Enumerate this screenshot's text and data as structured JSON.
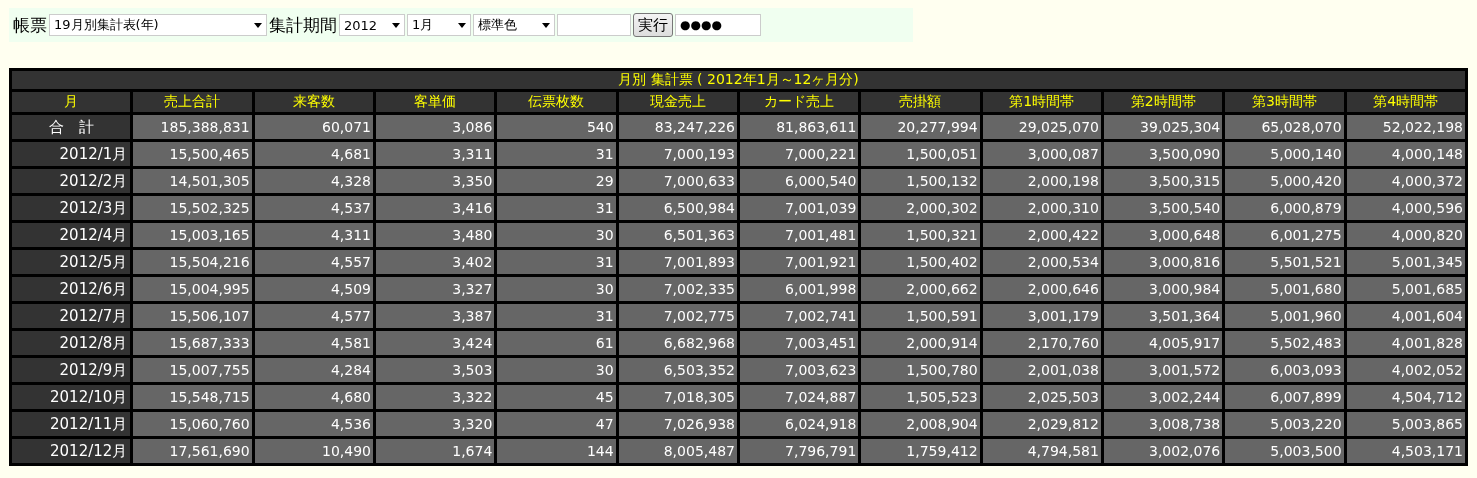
{
  "toolbar": {
    "report_label": "帳票",
    "report_select": "19月別集計表(年)",
    "period_label": "集計期間",
    "year_select": "2012",
    "month_select": "1月",
    "color_select": "標準色",
    "run_button": "実行",
    "password_field": "●●●●"
  },
  "table": {
    "title": "月別 集計票 ( 2012年1月～12ヶ月分)",
    "columns": [
      "月",
      "売上合計",
      "来客数",
      "客単価",
      "伝票枚数",
      "現金売上",
      "カード売上",
      "売掛額",
      "第1時間帯",
      "第2時間帯",
      "第3時間帯",
      "第4時間帯"
    ],
    "rows": [
      {
        "kind": "total",
        "cells": [
          "合　計",
          "185,388,831",
          "60,071",
          "3,086",
          "540",
          "83,247,226",
          "81,863,611",
          "20,277,994",
          "29,025,070",
          "39,025,304",
          "65,028,070",
          "52,022,198"
        ]
      },
      {
        "kind": "month",
        "cells": [
          "2012/1月",
          "15,500,465",
          "4,681",
          "3,311",
          "31",
          "7,000,193",
          "7,000,221",
          "1,500,051",
          "3,000,087",
          "3,500,090",
          "5,000,140",
          "4,000,148"
        ]
      },
      {
        "kind": "month",
        "cells": [
          "2012/2月",
          "14,501,305",
          "4,328",
          "3,350",
          "29",
          "7,000,633",
          "6,000,540",
          "1,500,132",
          "2,000,198",
          "3,500,315",
          "5,000,420",
          "4,000,372"
        ]
      },
      {
        "kind": "month",
        "cells": [
          "2012/3月",
          "15,502,325",
          "4,537",
          "3,416",
          "31",
          "6,500,984",
          "7,001,039",
          "2,000,302",
          "2,000,310",
          "3,500,540",
          "6,000,879",
          "4,000,596"
        ]
      },
      {
        "kind": "month",
        "cells": [
          "2012/4月",
          "15,003,165",
          "4,311",
          "3,480",
          "30",
          "6,501,363",
          "7,001,481",
          "1,500,321",
          "2,000,422",
          "3,000,648",
          "6,001,275",
          "4,000,820"
        ]
      },
      {
        "kind": "month",
        "cells": [
          "2012/5月",
          "15,504,216",
          "4,557",
          "3,402",
          "31",
          "7,001,893",
          "7,001,921",
          "1,500,402",
          "2,000,534",
          "3,000,816",
          "5,501,521",
          "5,001,345"
        ]
      },
      {
        "kind": "month",
        "cells": [
          "2012/6月",
          "15,004,995",
          "4,509",
          "3,327",
          "30",
          "7,002,335",
          "6,001,998",
          "2,000,662",
          "2,000,646",
          "3,000,984",
          "5,001,680",
          "5,001,685"
        ]
      },
      {
        "kind": "month",
        "cells": [
          "2012/7月",
          "15,506,107",
          "4,577",
          "3,387",
          "31",
          "7,002,775",
          "7,002,741",
          "1,500,591",
          "3,001,179",
          "3,501,364",
          "5,001,960",
          "4,001,604"
        ]
      },
      {
        "kind": "month",
        "cells": [
          "2012/8月",
          "15,687,333",
          "4,581",
          "3,424",
          "61",
          "6,682,968",
          "7,003,451",
          "2,000,914",
          "2,170,760",
          "4,005,917",
          "5,502,483",
          "4,001,828"
        ]
      },
      {
        "kind": "month",
        "cells": [
          "2012/9月",
          "15,007,755",
          "4,284",
          "3,503",
          "30",
          "6,503,352",
          "7,003,623",
          "1,500,780",
          "2,001,038",
          "3,001,572",
          "6,003,093",
          "4,002,052"
        ]
      },
      {
        "kind": "month",
        "cells": [
          "2012/10月",
          "15,548,715",
          "4,680",
          "3,322",
          "45",
          "7,018,305",
          "7,024,887",
          "1,505,523",
          "2,025,503",
          "3,002,244",
          "6,007,899",
          "4,504,712"
        ]
      },
      {
        "kind": "month",
        "cells": [
          "2012/11月",
          "15,060,760",
          "4,536",
          "3,320",
          "47",
          "7,026,938",
          "6,024,918",
          "2,008,904",
          "2,029,812",
          "3,008,738",
          "5,003,220",
          "5,003,865"
        ]
      },
      {
        "kind": "month",
        "cells": [
          "2012/12月",
          "17,561,690",
          "10,490",
          "1,674",
          "144",
          "8,005,487",
          "7,796,791",
          "1,759,412",
          "4,794,581",
          "3,002,076",
          "5,003,500",
          "4,503,171"
        ]
      }
    ]
  }
}
